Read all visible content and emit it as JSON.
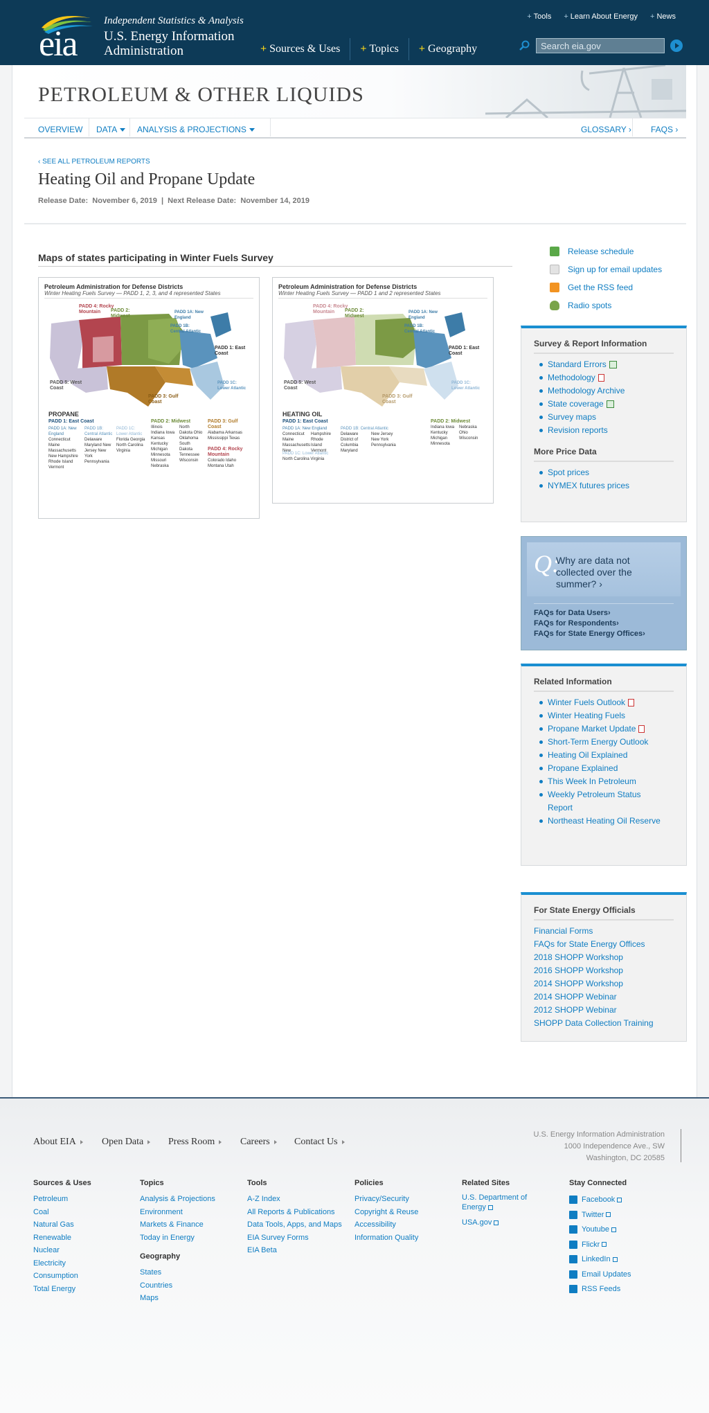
{
  "header": {
    "tagline": "Independent Statistics & Analysis",
    "org_name_1": "U.S. Energy Information",
    "org_name_2": "Administration",
    "logo_text": "eia",
    "top_links": [
      "Tools",
      "Learn About Energy",
      "News"
    ],
    "main_nav": [
      "Sources & Uses",
      "Topics",
      "Geography"
    ],
    "search_placeholder": "Search eia.gov"
  },
  "banner": {
    "title": "PETROLEUM & OTHER LIQUIDS"
  },
  "subnav": {
    "overview": "OVERVIEW",
    "data": "DATA",
    "analysis": "ANALYSIS & PROJECTIONS",
    "glossary": "GLOSSARY ›",
    "faqs": "FAQS ›"
  },
  "page": {
    "breadcrumb": "‹ SEE ALL PETROLEUM REPORTS",
    "title": "Heating Oil and Propane Update",
    "release_label": "Release Date:",
    "release_date": "November 6, 2019",
    "sep": "|",
    "next_label": "Next Release Date:",
    "next_date": "November 14, 2019",
    "section_title": "Maps of states participating in Winter Fuels Survey"
  },
  "maps": [
    {
      "title": "Petroleum Administration for Defense Districts",
      "subtitle": "Winter Heating Fuels Survey — PADD 1, 2, 3, and 4 represented States",
      "fuel": "PROPANE",
      "labels": {
        "p4": "PADD 4: Rocky Mountain",
        "p2": "PADD 2: Midwest",
        "p1a": "PADD 1A: New England",
        "p1b": "PADD 1B: Central Atlantic",
        "p1": "PADD 1: East Coast",
        "p5": "PADD 5: West Coast",
        "p1c": "PADD 1C: Lower Atlantic",
        "p3": "PADD 3: Gulf Coast"
      },
      "legend": {
        "padd1": "PADD 1: East Coast",
        "padd1a": "PADD 1A: New England",
        "padd1a_states": "Connecticut Maine Massachusetts New Hampshire Rhode Island Vermont",
        "padd1b": "PADD 1B: Central Atlantic",
        "padd1b_states": "Delaware Maryland New Jersey New York Pennsylvania",
        "padd1c": "PADD 1C: Lower Atlantic",
        "padd1c_states": "Florida Georgia North Carolina Virginia",
        "padd2": "PADD 2: Midwest",
        "padd2_states": "Illinois Indiana Iowa Kansas Kentucky Michigan Minnesota Missouri Nebraska North Dakota Ohio Oklahoma South Dakota Tennessee Wisconsin",
        "padd3": "PADD 3: Gulf Coast",
        "padd3_states": "Alabama Arkansas Mississippi Texas",
        "padd4": "PADD 4: Rocky Mountain",
        "padd4_states": "Colorado Idaho Montana Utah"
      }
    },
    {
      "title": "Petroleum Administration for Defense Districts",
      "subtitle": "Winter Heating Fuels Survey — PADD 1 and 2 represented States",
      "fuel": "HEATING OIL",
      "labels": {
        "p4": "PADD 4: Rocky Mountain",
        "p2": "PADD 2: Midwest",
        "p1a": "PADD 1A: New England",
        "p1b": "PADD 1B: Central Atlantic",
        "p1": "PADD 1: East Coast",
        "p5": "PADD 5: West Coast",
        "p1c": "PADD 1C: Lower Atlantic",
        "p3": "PADD 3: Gulf Coast"
      },
      "legend": {
        "padd1": "PADD 1: East Coast",
        "padd1a": "PADD 1A: New England",
        "padd1a_states": "Connecticut Maine Massachusetts New Hampshire Rhode Island Vermont",
        "padd1b": "PADD 1B: Central Atlantic",
        "padd1b_states": "Delaware District of Columbia Maryland New Jersey New York Pennsylvania",
        "padd1c": "PADD 1C: Lower Atlantic",
        "padd1c_states": "North Carolina Virginia",
        "padd2": "PADD 2: Midwest",
        "padd2_states": "Indiana Iowa Kentucky Michigan Minnesota Nebraska Ohio Wisconsin"
      }
    }
  ],
  "sidebar": {
    "links": [
      "Release schedule",
      "Sign up for email updates",
      "Get the RSS feed",
      "Radio spots"
    ],
    "survey_title": "Survey & Report Information",
    "survey_items": [
      "Standard Errors",
      "Methodology",
      "Methodology Archive",
      "State coverage",
      "Survey maps",
      "Revision reports"
    ],
    "price_title": "More Price Data",
    "price_items": [
      "Spot prices",
      "NYMEX futures prices"
    ],
    "faq_question": "Why are data not collected over the summer? ›",
    "faq_q_letter": "Q:",
    "faq_links": [
      "FAQs for Data Users›",
      "FAQs for Respondents›",
      "FAQs for State Energy Offices›"
    ],
    "related_title": "Related Information",
    "related_items": [
      "Winter Fuels Outlook",
      "Winter Heating Fuels",
      "Propane Market Update",
      "Short-Term Energy Outlook",
      "Heating Oil Explained",
      "Propane Explained",
      "This Week In Petroleum",
      "Weekly Petroleum Status Report",
      "Northeast Heating Oil Reserve"
    ],
    "state_title": "For State Energy Officials",
    "state_items": [
      "Financial Forms",
      "FAQs for State Energy Offices",
      "2018 SHOPP Workshop",
      "2016 SHOPP Workshop",
      "2014 SHOPP Workshop",
      "2014 SHOPP Webinar",
      "2012 SHOPP Webinar",
      "SHOPP Data Collection Training"
    ]
  },
  "footer": {
    "nav": [
      "About EIA",
      "Open Data",
      "Press Room",
      "Careers",
      "Contact Us"
    ],
    "address": [
      "U.S. Energy Information Administration",
      "1000 Independence Ave., SW",
      "Washington, DC 20585"
    ],
    "cols": {
      "sources_title": "Sources & Uses",
      "sources": [
        "Petroleum",
        "Coal",
        "Natural Gas",
        "Renewable",
        "Nuclear",
        "Electricity",
        "Consumption",
        "Total Energy"
      ],
      "topics_title": "Topics",
      "topics": [
        "Analysis & Projections",
        "Environment",
        "Markets & Finance",
        "Today in Energy"
      ],
      "geo_title": "Geography",
      "geo": [
        "States",
        "Countries",
        "Maps"
      ],
      "tools_title": "Tools",
      "tools": [
        "A-Z Index",
        "All Reports & Publications",
        "Data Tools, Apps, and Maps",
        "EIA Survey Forms",
        "EIA Beta"
      ],
      "policies_title": "Policies",
      "policies": [
        "Privacy/Security",
        "Copyright & Reuse",
        "Accessibility",
        "Information Quality"
      ],
      "related_title": "Related Sites",
      "related": [
        "U.S. Department of Energy",
        "USA.gov"
      ],
      "stay_title": "Stay Connected",
      "stay": [
        "Facebook",
        "Twitter",
        "Youtube",
        "Flickr",
        "LinkedIn",
        "Email Updates",
        "RSS Feeds"
      ]
    }
  },
  "colors": {
    "header_bg": "#0d3a57",
    "link": "#0f7dc2",
    "accent_bar": "#1a8fd1"
  }
}
